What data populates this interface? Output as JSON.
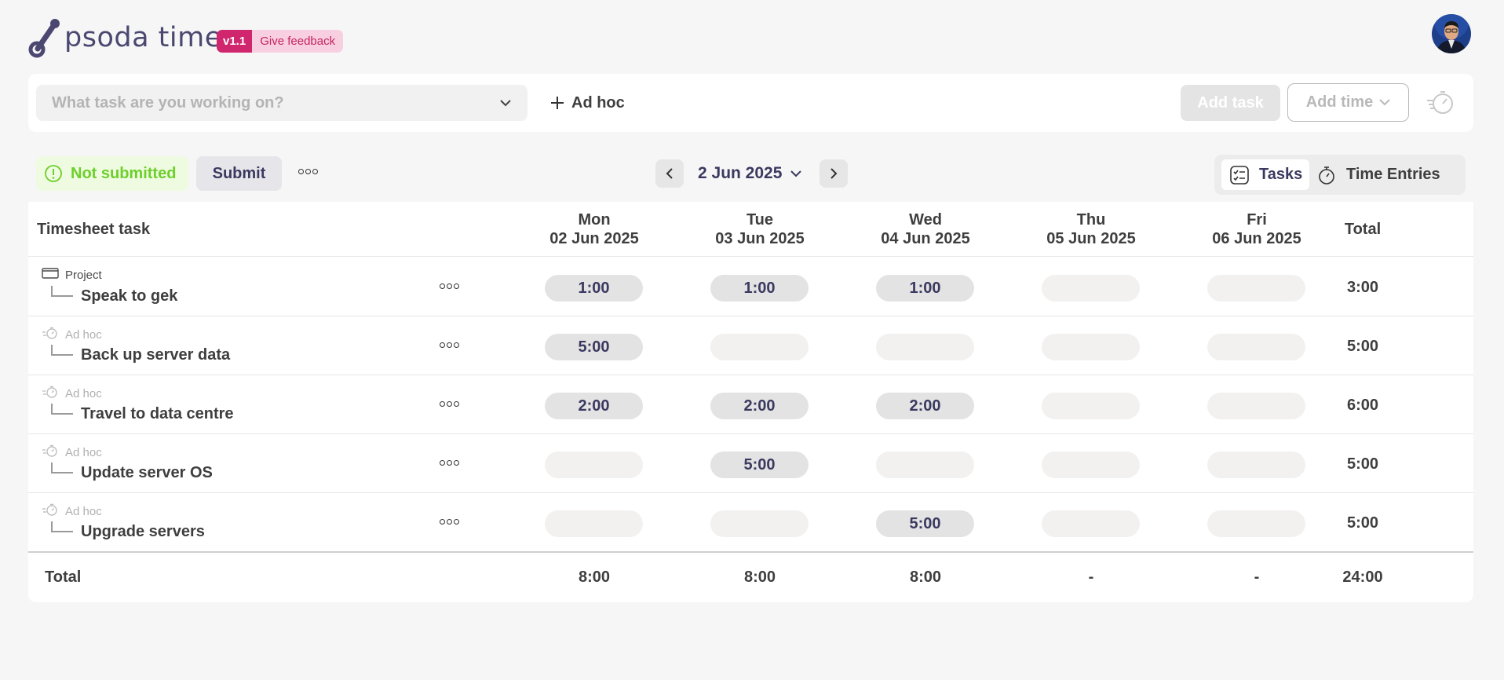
{
  "header": {
    "logo_text": "psoda time",
    "version": "v1.1",
    "feedback": "Give feedback"
  },
  "taskbar": {
    "task_placeholder": "What task are you working on?",
    "adhoc_label": "Ad hoc",
    "add_task_label": "Add task",
    "add_time_label": "Add time"
  },
  "timesheet": {
    "status": "Not submitted",
    "submit_label": "Submit",
    "date": "2 Jun 2025",
    "view_tasks": "Tasks",
    "view_time_entries": "Time Entries",
    "task_header": "Timesheet task",
    "total_header": "Total",
    "days": [
      {
        "day": "Mon",
        "date": "02 Jun 2025"
      },
      {
        "day": "Tue",
        "date": "03 Jun 2025"
      },
      {
        "day": "Wed",
        "date": "04 Jun 2025"
      },
      {
        "day": "Thu",
        "date": "05 Jun 2025"
      },
      {
        "day": "Fri",
        "date": "06 Jun 2025"
      }
    ],
    "rows": [
      {
        "type": "Project",
        "name": "Speak to gek",
        "hours": [
          "1:00",
          "1:00",
          "1:00",
          "",
          ""
        ],
        "total": "3:00"
      },
      {
        "type": "Ad hoc",
        "name": "Back up server data",
        "hours": [
          "5:00",
          "",
          "",
          "",
          ""
        ],
        "total": "5:00"
      },
      {
        "type": "Ad hoc",
        "name": "Travel to data centre",
        "hours": [
          "2:00",
          "2:00",
          "2:00",
          "",
          ""
        ],
        "total": "6:00"
      },
      {
        "type": "Ad hoc",
        "name": "Update server OS",
        "hours": [
          "",
          "5:00",
          "",
          "",
          ""
        ],
        "total": "5:00"
      },
      {
        "type": "Ad hoc",
        "name": "Upgrade servers",
        "hours": [
          "",
          "",
          "5:00",
          "",
          ""
        ],
        "total": "5:00"
      }
    ],
    "footer": {
      "label": "Total",
      "day_totals": [
        "8:00",
        "8:00",
        "8:00",
        "-",
        "-"
      ],
      "grand_total": "24:00"
    }
  },
  "colors": {
    "brand": "#d0266e",
    "accent": "#3a3960",
    "status_green": "#6ccf2b"
  }
}
